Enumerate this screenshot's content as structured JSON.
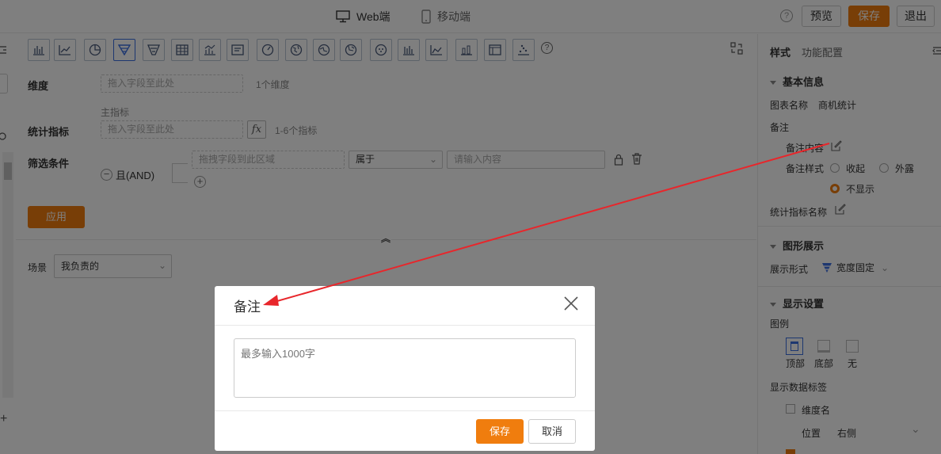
{
  "topbar": {
    "tab_web": "Web端",
    "tab_mobile": "移动端",
    "help": "?",
    "preview": "预览",
    "save": "保存",
    "exit": "退出"
  },
  "toolbar": {
    "help": "?",
    "chart_icons": [
      "bar-chart",
      "line-chart",
      "pie-chart",
      "funnel-chart",
      "funnel-chart-alt",
      "table",
      "combo-chart",
      "text-card",
      "gauge",
      "map",
      "map-alt",
      "map-alt-2",
      "pie-alt",
      "bar-alt",
      "line-alt",
      "stacked-bar",
      "pivot-table",
      "scatter-chart"
    ],
    "active_icon": "funnel-chart"
  },
  "form": {
    "dimension_label": "维度",
    "dimension_placeholder": "拖入字段至此处",
    "dimension_hint": "1个维度",
    "main_metric_label": "主指标",
    "metric_label": "统计指标",
    "metric_placeholder": "拖入字段至此处",
    "fx": "fx",
    "metric_hint": "1-6个指标",
    "filter_label": "筛选条件",
    "filter_drop_placeholder": "拖拽字段到此区域",
    "filter_operator": "属于",
    "filter_value_placeholder": "请输入内容",
    "logic_and": "且(AND)",
    "apply": "应用",
    "scene_label": "场景",
    "scene_value": "我负责的"
  },
  "right_panel": {
    "tab_style": "样式",
    "tab_function": "功能配置",
    "basic_info": "基本信息",
    "chart_name_label": "图表名称",
    "chart_name_value": "商机统计",
    "remark_label": "备注",
    "remark_content_label": "备注内容",
    "remark_style_label": "备注样式",
    "remark_style_options": [
      "收起",
      "外露",
      "不显示"
    ],
    "remark_style_selected": "不显示",
    "metric_name_label": "统计指标名称",
    "graphic_section": "图形展示",
    "display_form_label": "展示形式",
    "display_form_value": "宽度固定",
    "display_settings": "显示设置",
    "legend_label": "图例",
    "legend_options": [
      "顶部",
      "底部",
      "无"
    ],
    "legend_selected": "顶部",
    "data_label_title": "显示数据标签",
    "dimension_name_check": "维度名",
    "position_label": "位置",
    "position_value": "右侧"
  },
  "dialog": {
    "title": "备注",
    "textarea_placeholder": "最多输入1000字",
    "save": "保存",
    "cancel": "取消"
  },
  "colors": {
    "accent": "#f07d0e",
    "active_icon": "#3b6fe0",
    "annotation_arrow": "#e8262b"
  }
}
